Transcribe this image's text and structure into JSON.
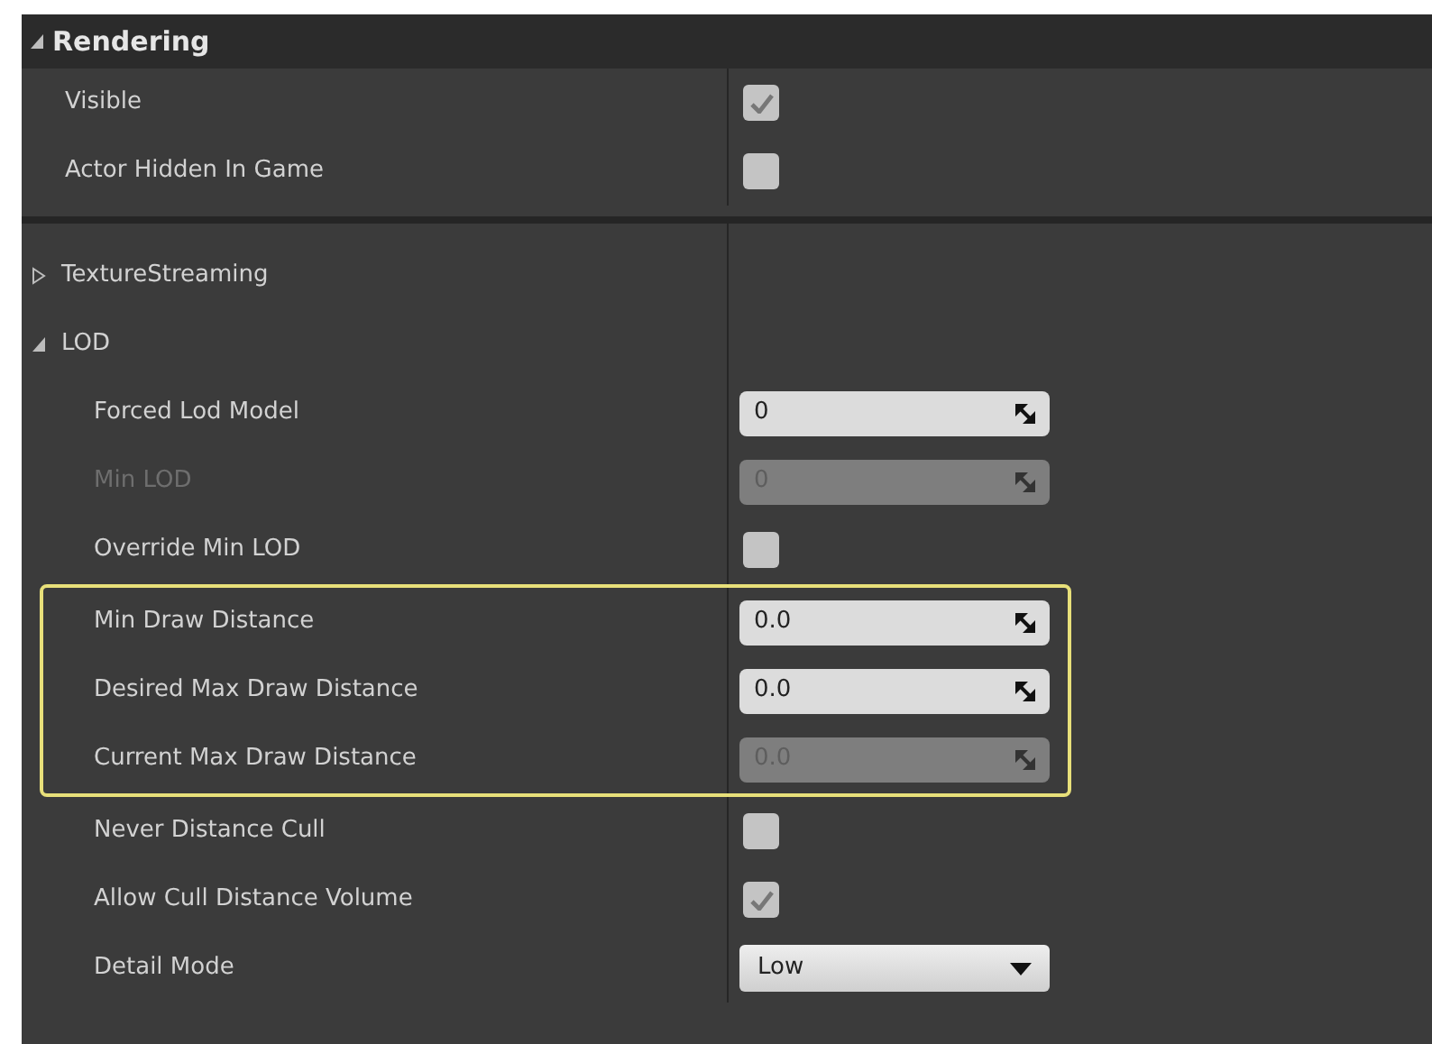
{
  "category": {
    "title": "Rendering",
    "expanded": true
  },
  "rows": [
    {
      "kind": "checkbox",
      "label": "Visible",
      "checked": true
    },
    {
      "kind": "checkbox",
      "label": "Actor Hidden In Game",
      "checked": false
    },
    {
      "kind": "separator"
    },
    {
      "kind": "group",
      "label": "TextureStreaming",
      "expanded": false
    },
    {
      "kind": "group",
      "label": "LOD",
      "expanded": true,
      "children": [
        {
          "kind": "number",
          "label": "Forced Lod Model",
          "value": "0",
          "disabled": false,
          "dimmed": false,
          "highlighted": false
        },
        {
          "kind": "number",
          "label": "Min LOD",
          "value": "0",
          "disabled": true,
          "dimmed": true,
          "highlighted": false
        },
        {
          "kind": "checkbox",
          "label": "Override Min LOD",
          "checked": false,
          "dimmed": false,
          "highlighted": false
        },
        {
          "kind": "number",
          "label": "Min Draw Distance",
          "value": "0.0",
          "disabled": false,
          "dimmed": false,
          "highlighted": true
        },
        {
          "kind": "number",
          "label": "Desired Max Draw Distance",
          "value": "0.0",
          "disabled": false,
          "dimmed": false,
          "highlighted": true
        },
        {
          "kind": "number",
          "label": "Current Max Draw Distance",
          "value": "0.0",
          "disabled": true,
          "dimmed": false,
          "highlighted": true
        },
        {
          "kind": "checkbox",
          "label": "Never Distance Cull",
          "checked": false,
          "dimmed": false,
          "highlighted": false
        },
        {
          "kind": "checkbox",
          "label": "Allow Cull Distance Volume",
          "checked": true,
          "dimmed": false,
          "highlighted": false
        },
        {
          "kind": "dropdown",
          "label": "Detail Mode",
          "value": "Low",
          "dimmed": false,
          "highlighted": false
        }
      ]
    }
  ]
}
